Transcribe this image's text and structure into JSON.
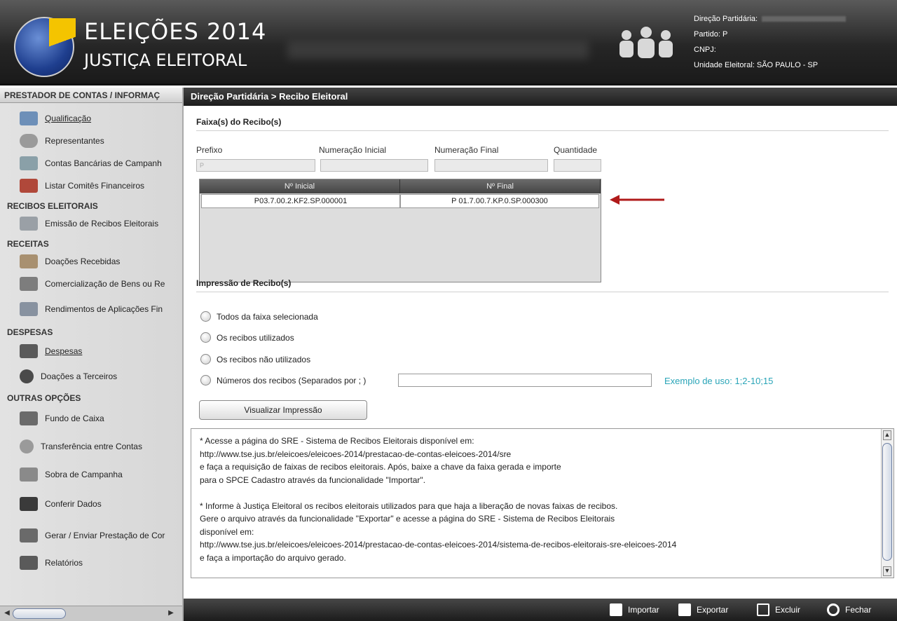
{
  "header": {
    "title_line1": "ELEIÇÕES 2014",
    "title_line2": "JUSTIÇA ELEITORAL",
    "info": {
      "direcao_label": "Direção Partidária:",
      "partido_label": "Partido: P",
      "cnpj_label": "CNPJ:",
      "unidade_label": "Unidade Eleitoral: SÃO PAULO - SP"
    }
  },
  "sidebar": {
    "header": "PRESTADOR DE CONTAS / INFORMAÇ",
    "items": [
      {
        "label": "Qualificação"
      },
      {
        "label": "Representantes"
      },
      {
        "label": "Contas Bancárias de Campanh"
      },
      {
        "label": "Listar Comitês Financeiros"
      }
    ],
    "section_recibos": "RECIBOS ELEITORAIS",
    "recibos_items": [
      {
        "label": "Emissão de Recibos Eleitorais"
      }
    ],
    "section_receitas": "RECEITAS",
    "receitas_items": [
      {
        "label": "Doações Recebidas"
      },
      {
        "label": "Comercialização de Bens ou Re"
      },
      {
        "label": "Rendimentos de Aplicações Fin"
      }
    ],
    "section_despesas": "DESPESAS",
    "despesas_items": [
      {
        "label": "Despesas"
      },
      {
        "label": "Doações a Terceiros"
      }
    ],
    "section_outras": "OUTRAS OPÇÕES",
    "outras_items": [
      {
        "label": "Fundo de Caixa"
      },
      {
        "label": "Transferência entre Contas"
      },
      {
        "label": "Sobra de Campanha"
      },
      {
        "label": "Conferir Dados"
      },
      {
        "label": "Gerar / Enviar Prestação de Cor"
      },
      {
        "label": "Relatórios"
      }
    ]
  },
  "main": {
    "breadcrumb": "Direção Partidária > Recibo Eleitoral",
    "faixa_title": "Faixa(s) do Recibo(s)",
    "labels": {
      "prefixo": "Prefixo",
      "num_inicial": "Numeração Inicial",
      "num_final": "Numeração Final",
      "quantidade": "Quantidade"
    },
    "prefixo_value": "P",
    "grid": {
      "headers": [
        "Nº Inicial",
        "Nº Final"
      ],
      "rows": [
        [
          "P03.7.00.2.KF2.SP.000001",
          "P 01.7.00.7.KP.0.SP.000300"
        ]
      ]
    },
    "impressao_title": "Impressão de Recibo(s)",
    "radios": [
      "Todos da faixa selecionada",
      "Os recibos utilizados",
      "Os recibos não utilizados",
      "Números dos recibos  (Separados por ; )"
    ],
    "example": "Exemplo de uso: 1;2-10;15",
    "visualizar_button": "Visualizar Impressão",
    "info_text": "* Acesse a página do SRE - Sistema de Recibos Eleitorais disponível em:\nhttp://www.tse.jus.br/eleicoes/eleicoes-2014/prestacao-de-contas-eleicoes-2014/sre\ne faça a requisição de faixas de recibos eleitorais. Após, baixe a chave da faixa gerada e importe\npara o SPCE Cadastro através da funcionalidade \"Importar\".\n\n* Informe à Justiça Eleitoral os recibos eleitorais utilizados para que haja a liberação de novas faixas de recibos.\nGere o arquivo através da funcionalidade \"Exportar\" e acesse a página do SRE - Sistema de Recibos Eleitorais\ndisponível em:\nhttp://www.tse.jus.br/eleicoes/eleicoes-2014/prestacao-de-contas-eleicoes-2014/sistema-de-recibos-eleitorais-sre-eleicoes-2014\ne faça a importação do arquivo gerado."
  },
  "footer": {
    "importar": "Importar",
    "exportar": "Exportar",
    "excluir": "Excluir",
    "fechar": "Fechar"
  }
}
